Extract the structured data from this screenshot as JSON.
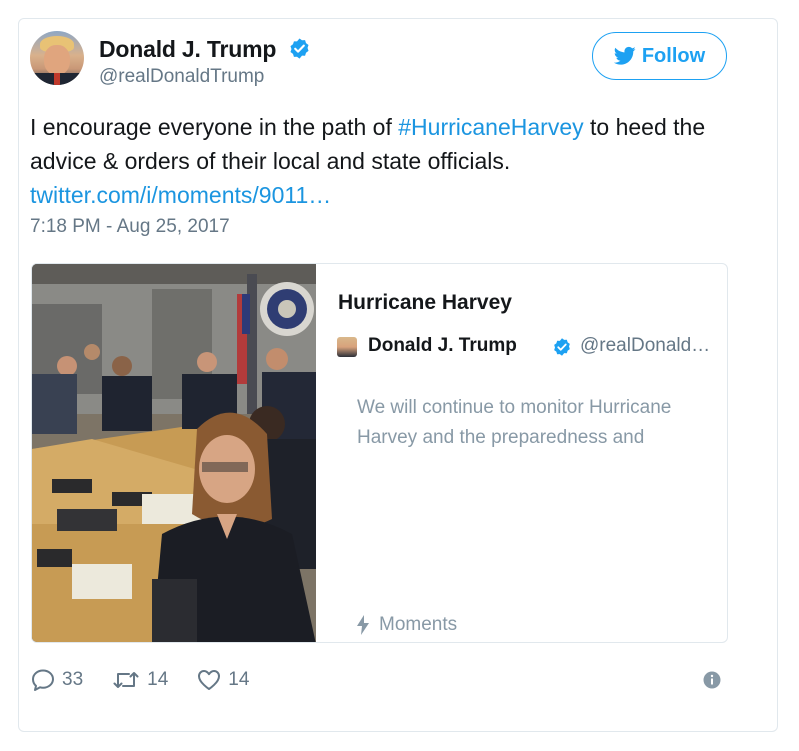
{
  "author": {
    "name": "Donald J. Trump",
    "handle": "@realDonaldTrump"
  },
  "follow_label": "Follow",
  "tweet": {
    "text_before": "I encourage everyone in the path of ",
    "hashtag": "#HurricaneHarvey",
    "text_after": " to heed the advice & orders of their local and state officials.",
    "link": "twitter.com/i/moments/9011…",
    "timestamp": "7:18 PM - Aug 25, 2017"
  },
  "moment": {
    "title": "Hurricane Harvey",
    "author_name": "Donald J. Trump",
    "author_handle": "@realDonald…",
    "text": "We will continue to monitor Hurricane Harvey and the preparedness and",
    "footer_label": "Moments"
  },
  "stats": {
    "replies": "33",
    "retweets": "14",
    "likes": "14"
  },
  "colors": {
    "accent": "#1da1f2",
    "link": "#1b95e0",
    "muted": "#657786",
    "text": "#14171a",
    "border": "#e1e8ed"
  },
  "icons": [
    "verified-badge-icon",
    "twitter-bird-icon",
    "lightning-icon",
    "reply-icon",
    "retweet-icon",
    "heart-icon",
    "info-icon"
  ]
}
